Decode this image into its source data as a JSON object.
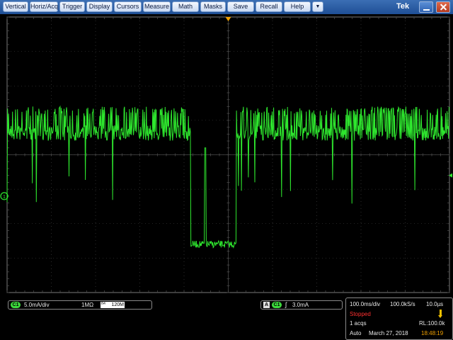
{
  "menu": {
    "items": [
      "Vertical",
      "Horiz/Acq",
      "Trigger",
      "Display",
      "Cursors",
      "Measure",
      "Math",
      "Masks",
      "Save",
      "Recall",
      "Help"
    ],
    "dropdown_glyph": "▼",
    "brand": "Tek"
  },
  "colors": {
    "trace": "#2ee62e",
    "graticule": "#4a4a4a",
    "marker": "#f0a000",
    "stopped": "#ff3030",
    "time": "#f0a000"
  },
  "channel_panel": {
    "ch_tag": "C1",
    "scale": "5.0mA/div",
    "impedance": "1MΩ",
    "bandwidth_icon": "bw-limit-icon",
    "bandwidth": "120M"
  },
  "trigger_panel": {
    "source_tag": "A",
    "ch_tag": "C1",
    "slope_icon": "rising-edge-icon",
    "slope_glyph": "ʃ",
    "level": "3.0mA"
  },
  "acq_panel": {
    "timebase": "100.0ms/div",
    "sample_rate": "100.0kS/s",
    "resolution": "10.0µs",
    "state": "Stopped",
    "acqs": "1 acqs",
    "record_length": "RL:100.0k",
    "mode": "Auto",
    "date": "March 27, 2018",
    "time": "18:48:19"
  },
  "waveform": {
    "channel": 1,
    "ground_marker": "1",
    "units": "mA",
    "description_levels": {
      "high_band_top_div": -1.4,
      "high_band_bottom_div": -0.2,
      "low_level_div": 2.6
    }
  }
}
